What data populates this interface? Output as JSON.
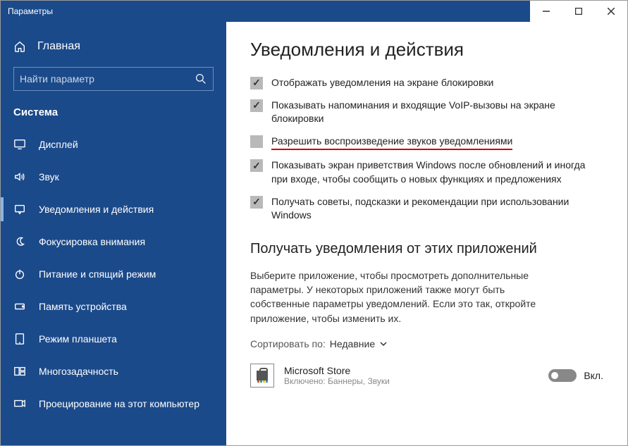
{
  "window": {
    "title": "Параметры"
  },
  "sidebar": {
    "home": "Главная",
    "search_placeholder": "Найти параметр",
    "section": "Система",
    "items": [
      {
        "label": "Дисплей"
      },
      {
        "label": "Звук"
      },
      {
        "label": "Уведомления и действия"
      },
      {
        "label": "Фокусировка внимания"
      },
      {
        "label": "Питание и спящий режим"
      },
      {
        "label": "Память устройства"
      },
      {
        "label": "Режим планшета"
      },
      {
        "label": "Многозадачность"
      },
      {
        "label": "Проецирование на этот компьютер"
      }
    ]
  },
  "page": {
    "title": "Уведомления и действия",
    "checks": [
      {
        "label": "Отображать уведомления на экране блокировки",
        "checked": true
      },
      {
        "label": "Показывать напоминания и входящие VoIP-вызовы на экране блокировки",
        "checked": true
      },
      {
        "label": "Разрешить  воспроизведение звуков уведомлениями",
        "checked": false,
        "highlight": true
      },
      {
        "label": "Показывать экран приветствия Windows после обновлений и иногда при входе, чтобы сообщить о новых функциях и предложениях",
        "checked": true
      },
      {
        "label": "Получать советы, подсказки и рекомендации при использовании Windows",
        "checked": true
      }
    ],
    "apps_heading": "Получать уведомления от этих приложений",
    "apps_desc": "Выберите приложение, чтобы просмотреть дополнительные параметры. У некоторых приложений также могут быть собственные параметры уведомлений. Если это так, откройте приложение, чтобы изменить их.",
    "sort_label": "Сортировать по:",
    "sort_value": "Недавние",
    "app": {
      "name": "Microsoft Store",
      "sub": "Включено: Баннеры, Звуки",
      "toggle_label": "Вкл."
    }
  }
}
